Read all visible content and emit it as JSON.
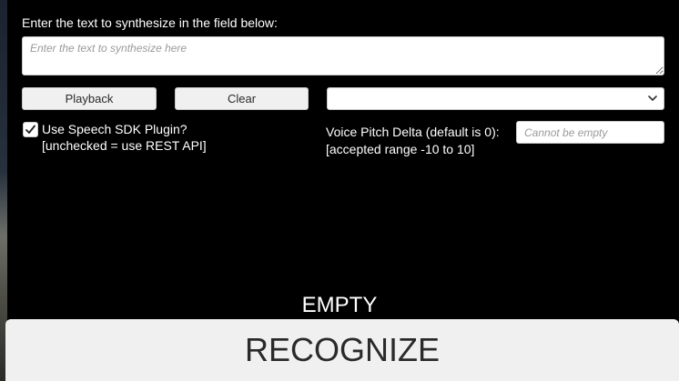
{
  "prompt": {
    "label": "Enter the text to synthesize in the field below:",
    "input_value": "",
    "input_placeholder": "Enter the text to synthesize here"
  },
  "buttons": {
    "playback_label": "Playback",
    "clear_label": "Clear"
  },
  "voice_dropdown": {
    "selected_value": "",
    "icon": "chevron-down-icon"
  },
  "sdk_option": {
    "checked": true,
    "label_line1": "Use Speech SDK Plugin?",
    "label_line2": "[unchecked = use REST API]",
    "icon": "check-icon"
  },
  "pitch": {
    "label_line1": "Voice Pitch Delta (default is 0):",
    "label_line2": "[accepted range -10 to 10]",
    "input_value": "",
    "input_placeholder": "Cannot be empty"
  },
  "status": {
    "text": "EMPTY"
  },
  "recognize": {
    "label": "RECOGNIZE"
  },
  "colors": {
    "background": "#000000",
    "button_bg": "#f0f0f0",
    "text_light": "#ffffff",
    "text_dark": "#2a2a2a",
    "placeholder": "#9a9a9a"
  }
}
